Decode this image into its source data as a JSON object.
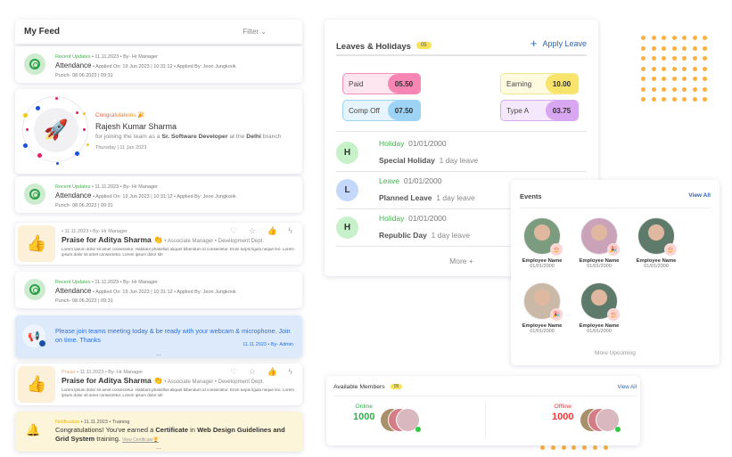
{
  "feed": {
    "title": "My Feed",
    "filter_label": "Filter",
    "attendance": {
      "category": "Recent Updates",
      "meta": " • 11.11.2023 • By- Hr Manager",
      "title": "Attendance",
      "details": " • Applied On: 19 Jun 2023 | 10:31:12 • Applied By: Jeon Jungkook",
      "punch": "Punch- 08.06.2023 | 09:31"
    },
    "congrats": {
      "label": "Congratulations 🎉",
      "name": "Rajesh Kumar Sharma",
      "desc_pre": "for joining the team as a ",
      "role": "Sr. Software Developer",
      "desc_mid": " at the ",
      "branch": "Delhi",
      "desc_post": " branch",
      "date": "Thursday | 11 Jan 2023"
    },
    "praise1": {
      "meta": "• 11.11.2023 • By- Hr Manager",
      "title": "Praise for Aditya Sharma 👏",
      "sub": " • Associate Manager • Development Dept.",
      "body": "Lorem ipsum dolor sit amet consectetur. Habitant phasellus aliquet bibendum id consectetur. Enim turpis ligula neque leo. Lorem ipsum dolor sit amet consectetur. Lorem ipsum dolor sit!"
    },
    "praise2": {
      "category": "Praise",
      "meta": " • 11.11.2023 • By- Hr Manager",
      "title": "Praise for Aditya Sharma 👏",
      "sub": " • Associate Manager • Development Dept.",
      "body": "Lorem ipsum dolor sit amet consectetur. Habitant phasellus aliquet bibendum id consectetur. Enim turpis ligula neque leo. Lorem ipsum dolor sit amet consectetur. Lorem ipsum dolor sit!"
    },
    "announcement": {
      "text": "Please join teams meeting today & be ready with your webcam & microphone. Join on time. Thanks",
      "meta": "11.11.2023 • By- Admin",
      "more": "..."
    },
    "notification": {
      "category": "Notification",
      "meta": " • 11.11.2023 • Training",
      "text_pre": "Congratulations! You've earned a ",
      "cert": "Certificate",
      "text_mid": " in ",
      "course": "Web Design Guidelines and Grid System",
      "text_post": " training.",
      "link": "View Certificate🏆",
      "more": "..."
    },
    "reactions": "♡ ☆ 👍 ϟ"
  },
  "leaves": {
    "title": "Leaves & Holidays",
    "count": "05",
    "apply_label": "Apply Leave",
    "balances": [
      {
        "label": "Paid",
        "value": "05.50",
        "bg": "#fde6ef",
        "border": "#f48fb8",
        "accent": "#f786b5"
      },
      {
        "label": "Earning",
        "value": "10.00",
        "bg": "#fefbe0",
        "border": "#f4e68c",
        "accent": "#f8e36b"
      },
      {
        "label": "Comp Off",
        "value": "07.50",
        "bg": "#e6f4fd",
        "border": "#9fd3f4",
        "accent": "#9dd4f6"
      },
      {
        "label": "Type A",
        "value": "03.75",
        "bg": "#f5e8fc",
        "border": "#d6aaf0",
        "accent": "#d9a6f1"
      }
    ],
    "items": [
      {
        "initial": "H",
        "type": "Holiday",
        "date": "01/01/2000",
        "name": "Special Holiday",
        "duration": "1 day leave",
        "color": "#c7f2c9"
      },
      {
        "initial": "L",
        "type": "Leave",
        "date": "01/01/2000",
        "name": "Planned Leave",
        "duration": "1 day leave",
        "color": "#c3d8fb"
      },
      {
        "initial": "H",
        "type": "Holiday",
        "date": "01/01/2000",
        "name": "Republic Day",
        "duration": "1 day leave",
        "color": "#c7f2c9"
      }
    ],
    "more_label": "More +"
  },
  "events": {
    "title": "Events",
    "view_all": "View All",
    "employees": [
      {
        "name": "Employee Name",
        "date": "01/01/2000",
        "badge": "🎂",
        "photo": "#7b9c7f"
      },
      {
        "name": "Employee Name",
        "date": "01/01/2000",
        "badge": "🎉",
        "photo": "#caa3b8"
      },
      {
        "name": "Employee Name",
        "date": "01/01/2000",
        "badge": "🎂",
        "photo": "#5d7a6a"
      },
      {
        "name": "Employee Name",
        "date": "01/01/2000",
        "badge": "🎉",
        "photo": "#c9b9a6"
      },
      {
        "name": "Employee Name",
        "date": "01/01/2000",
        "badge": "🎂",
        "photo": "#5d7a6a"
      }
    ],
    "more_label": "More Upcoming"
  },
  "members": {
    "title": "Available Members",
    "count": "05",
    "view_all": "View All",
    "online_label": "Online",
    "online_count": "1000",
    "offline_label": "Offline",
    "offline_count": "1000",
    "online_color": "#2db34a",
    "offline_color": "#e83a3a"
  }
}
